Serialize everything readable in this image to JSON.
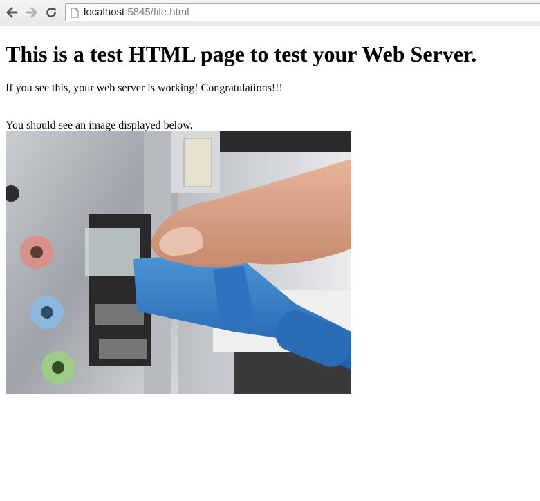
{
  "browser": {
    "url_host": "localhost",
    "url_rest": ":5845/file.html",
    "icons": {
      "back": "arrow-left-icon",
      "forward": "arrow-right-icon",
      "reload": "reload-icon",
      "page": "page-icon"
    }
  },
  "page": {
    "heading": "This is a test HTML page to test your Web Server.",
    "paragraph1": "If you see this, your web server is working! Congratulations!!!",
    "paragraph2": "You should see an image displayed below."
  }
}
